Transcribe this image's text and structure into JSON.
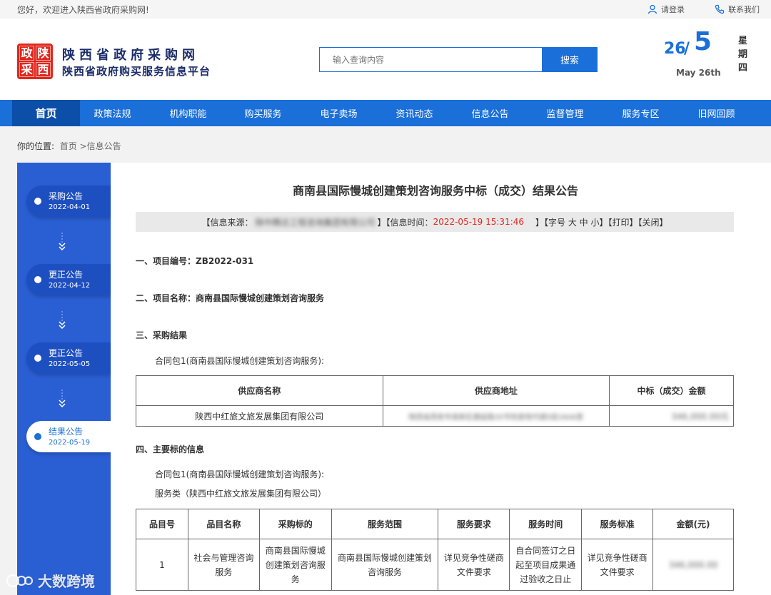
{
  "topbar": {
    "welcome": "您好，欢迎进入陕西省政府采购网!",
    "login": "请登录",
    "contact": "联系我们"
  },
  "header": {
    "seal": [
      "政",
      "陕",
      "采",
      "西"
    ],
    "site_name": "陕西省政府采购网",
    "site_sub": "陕西省政府购买服务信息平台",
    "search_placeholder": "输入查询内容",
    "search_button": "搜索",
    "date_day": "26",
    "date_slash": "/",
    "date_month": "5",
    "date_en": "May 26th",
    "weekday": "星期四"
  },
  "nav": {
    "items": [
      "首页",
      "政策法规",
      "机构职能",
      "购买服务",
      "电子卖场",
      "资讯动态",
      "信息公告",
      "监督管理",
      "服务专区",
      "旧网回顾"
    ]
  },
  "breadcrumb": {
    "label": "你的位置:",
    "home": "首页",
    "sep": ">",
    "current": "信息公告"
  },
  "sidebar": {
    "items": [
      {
        "title": "采购公告",
        "date": "2022-04-01"
      },
      {
        "title": "更正公告",
        "date": "2022-04-12"
      },
      {
        "title": "更正公告",
        "date": "2022-05-05"
      },
      {
        "title": "结果公告",
        "date": "2022-05-19"
      }
    ]
  },
  "doc": {
    "title": "商南县国际慢城创建策划咨询服务中标（成交）结果公告",
    "meta_source_label": "【信息来源：",
    "meta_source_value": "陕中腾达工程咨询集团有限公司",
    "meta_time_label": "】【信息时间：",
    "meta_time_value": "2022-05-19 15:31:46",
    "meta_tail": "】【字号 大 中 小】【打印】【关闭】",
    "sec1": "一、项目编号：ZB2022-031",
    "sec2": "二、项目名称：商南县国际慢城创建策划咨询服务",
    "sec3": "三、采购结果",
    "pkg1": "合同包1(商南县国际慢城创建策划咨询服务):",
    "result_table": {
      "headers": [
        "供应商名称",
        "供应商地址",
        "中标（成交）金额"
      ],
      "row": [
        "陕西中红旅文旅发展集团有限公司",
        "陕西省西安市高新区唐延路35号旺座现代城5层2606室",
        "346,000.00元"
      ]
    },
    "sec4": "四、主要标的信息",
    "pkg1b": "合同包1(商南县国际慢城创建策划咨询服务):",
    "service_type": "服务类（陕西中红旅文旅发展集团有限公司）",
    "item_table": {
      "headers": [
        "品目号",
        "品目名称",
        "采购标的",
        "服务范围",
        "服务要求",
        "服务时间",
        "服务标准",
        "金额(元)"
      ],
      "row": [
        "1",
        "社会与管理咨询服务",
        "商南县国际慢城创建策划咨询服务",
        "商南县国际慢城创建策划咨询服务",
        "详见竞争性磋商文件要求",
        "自合同签订之日起至项目成果通过验收之日止",
        "详见竞争性磋商文件要求",
        "346,000.00"
      ]
    }
  },
  "watermark": "大数跨境",
  "colors": {
    "primary": "#1a6fd8",
    "nav_active": "#0c4fa8",
    "sidebar": "#2a5fd4",
    "logo_red": "#e1261c"
  }
}
